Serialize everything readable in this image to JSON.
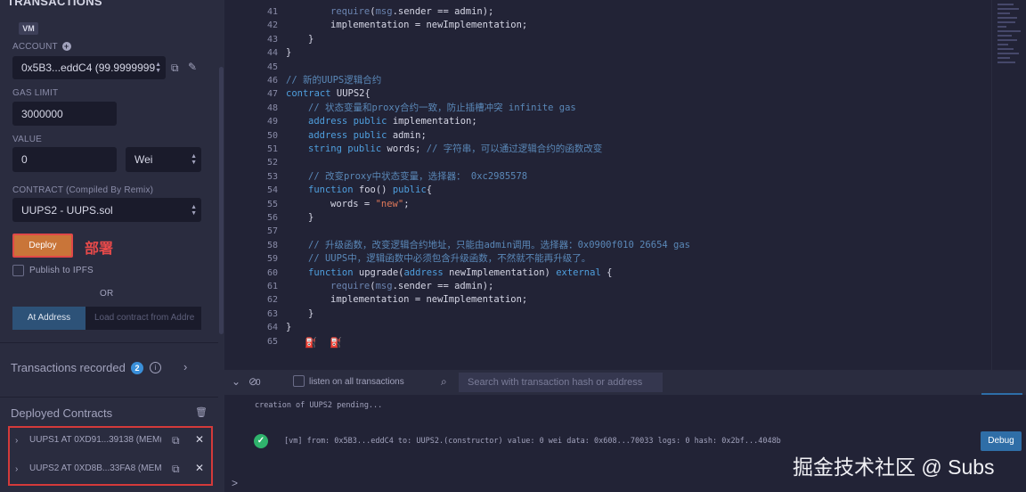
{
  "panel": {
    "title": "TRANSACTIONS",
    "environment": "VM",
    "account_label": "ACCOUNT",
    "account_value": "0x5B3...eddC4 (99.9999999",
    "gas_limit_label": "GAS LIMIT",
    "gas_limit_value": "3000000",
    "value_label": "VALUE",
    "value_amount": "0",
    "value_unit": "Wei",
    "contract_label": "CONTRACT (Compiled By Remix)",
    "contract_value": "UUPS2 - UUPS.sol",
    "deploy_label": "Deploy",
    "deploy_annotation": "部署",
    "publish_label": "Publish to IPFS",
    "or_label": "OR",
    "at_address_label": "At Address",
    "load_placeholder": "Load contract from Addre",
    "tx_recorded_label": "Transactions recorded",
    "tx_recorded_count": "2",
    "deployed_label": "Deployed Contracts",
    "deployed": [
      {
        "name": "UUPS1 AT 0XD91...39138 (MEM("
      },
      {
        "name": "UUPS2 AT 0XD8B...33FA8 (MEM"
      }
    ]
  },
  "editor": {
    "lines": [
      {
        "n": "41",
        "indent": 2,
        "parts": [
          [
            "r",
            "require"
          ],
          [
            "t",
            "("
          ],
          [
            "r",
            "msg"
          ],
          [
            "t",
            ".sender == admin);"
          ]
        ]
      },
      {
        "n": "42",
        "indent": 2,
        "parts": [
          [
            "t",
            "implementation = newImplementation;"
          ]
        ]
      },
      {
        "n": "43",
        "indent": 1,
        "parts": [
          [
            "t",
            "}"
          ]
        ]
      },
      {
        "n": "44",
        "indent": 0,
        "parts": [
          [
            "t",
            "}"
          ]
        ]
      },
      {
        "n": "45",
        "indent": 0,
        "parts": []
      },
      {
        "n": "46",
        "indent": 0,
        "parts": [
          [
            "c",
            "// 新的UUPS逻辑合约"
          ]
        ]
      },
      {
        "n": "47",
        "indent": 0,
        "parts": [
          [
            "k",
            "contract"
          ],
          [
            "t",
            " UUPS2{"
          ]
        ]
      },
      {
        "n": "48",
        "indent": 1,
        "parts": [
          [
            "c",
            "// 状态变量和proxy合约一致，防止插槽冲突 infinite gas"
          ]
        ]
      },
      {
        "n": "49",
        "indent": 1,
        "parts": [
          [
            "k",
            "address public"
          ],
          [
            "t",
            " implementation;"
          ]
        ]
      },
      {
        "n": "50",
        "indent": 1,
        "parts": [
          [
            "k",
            "address public"
          ],
          [
            "t",
            " admin;"
          ]
        ]
      },
      {
        "n": "51",
        "indent": 1,
        "parts": [
          [
            "k",
            "string public"
          ],
          [
            "t",
            " words; "
          ],
          [
            "c",
            "// 字符串，可以通过逻辑合约的函数改变"
          ]
        ]
      },
      {
        "n": "52",
        "indent": 0,
        "parts": []
      },
      {
        "n": "53",
        "indent": 1,
        "parts": [
          [
            "c",
            "// 改变proxy中状态变量，选择器： 0xc2985578"
          ]
        ]
      },
      {
        "n": "54",
        "indent": 1,
        "parts": [
          [
            "k",
            "function"
          ],
          [
            "t",
            " foo() "
          ],
          [
            "k",
            "public"
          ],
          [
            "t",
            "{"
          ]
        ]
      },
      {
        "n": "55",
        "indent": 2,
        "parts": [
          [
            "t",
            "words = "
          ],
          [
            "s",
            "\"new\""
          ],
          [
            "t",
            ";"
          ]
        ]
      },
      {
        "n": "56",
        "indent": 1,
        "parts": [
          [
            "t",
            "}"
          ]
        ]
      },
      {
        "n": "57",
        "indent": 0,
        "parts": []
      },
      {
        "n": "58",
        "indent": 1,
        "parts": [
          [
            "c",
            "// 升级函数，改变逻辑合约地址，只能由admin调用。选择器：0x0900f010 26654 gas"
          ]
        ]
      },
      {
        "n": "59",
        "indent": 1,
        "parts": [
          [
            "c",
            "// UUPS中，逻辑函数中必须包含升级函数，不然就不能再升级了。"
          ]
        ]
      },
      {
        "n": "60",
        "indent": 1,
        "parts": [
          [
            "k",
            "function"
          ],
          [
            "t",
            " upgrade("
          ],
          [
            "k",
            "address"
          ],
          [
            "t",
            " newImplementation) "
          ],
          [
            "k",
            "external"
          ],
          [
            "t",
            " {"
          ]
        ]
      },
      {
        "n": "61",
        "indent": 2,
        "parts": [
          [
            "r",
            "require"
          ],
          [
            "t",
            "("
          ],
          [
            "r",
            "msg"
          ],
          [
            "t",
            ".sender == admin);"
          ]
        ]
      },
      {
        "n": "62",
        "indent": 2,
        "parts": [
          [
            "t",
            "implementation = newImplementation;"
          ]
        ]
      },
      {
        "n": "63",
        "indent": 1,
        "parts": [
          [
            "t",
            "}"
          ]
        ]
      },
      {
        "n": "64",
        "indent": 0,
        "parts": [
          [
            "t",
            "}"
          ]
        ]
      },
      {
        "n": "65",
        "indent": 0,
        "parts": []
      }
    ]
  },
  "terminal": {
    "listen_label": "listen on all transactions",
    "search_placeholder": "Search with transaction hash or address",
    "pending_text": "creation of UUPS2 pending...",
    "log_text": "[vm] from: 0x5B3...eddC4 to: UUPS2.(constructor) value: 0 wei data: 0x608...70033 logs: 0 hash: 0x2bf...4048b",
    "debug_label": "Debug",
    "prompt": ">"
  },
  "watermark": "掘金技术社区 @ Subs",
  "colors": {
    "panel_bg": "#2a2c3f",
    "editor_bg": "#222336",
    "keyword": "#4f9fde",
    "comment": "#5a88b8",
    "string": "#e0795a",
    "deploy": "#c97539",
    "annotation_red": "#d43a3a",
    "success": "#2fb36c",
    "primary": "#2f6ea7"
  }
}
